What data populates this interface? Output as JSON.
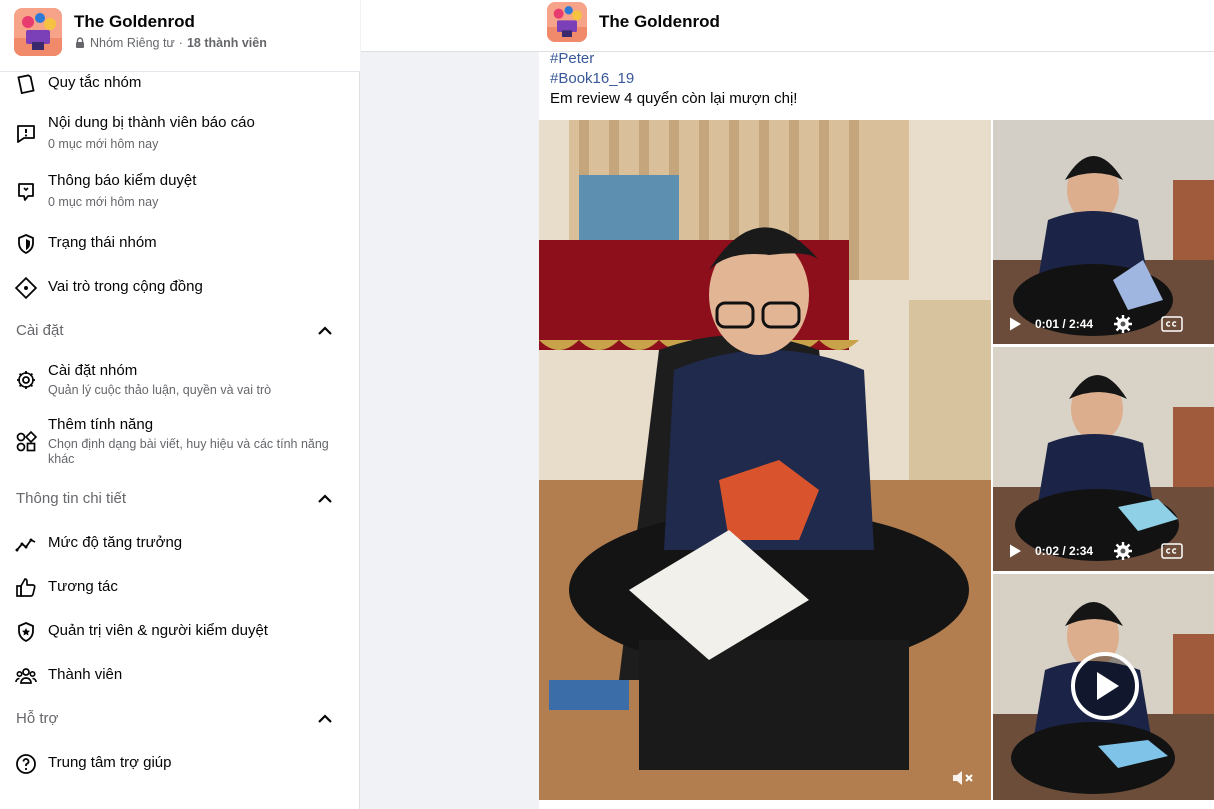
{
  "group": {
    "name": "The Goldenrod",
    "privacy": "Nhóm Riêng tư",
    "separator": "·",
    "members": "18 thành viên"
  },
  "sidebar": {
    "items": [
      {
        "label": "Quy tắc nhóm",
        "icon": "rules-icon"
      },
      {
        "label": "Nội dung bị thành viên báo cáo",
        "sub": "0 mục mới hôm nay",
        "icon": "report-icon"
      },
      {
        "label": "Thông báo kiểm duyệt",
        "sub": "0 mục mới hôm nay",
        "icon": "moderation-alert-icon"
      },
      {
        "label": "Trạng thái nhóm",
        "icon": "shield-icon"
      },
      {
        "label": "Vai trò trong cộng đồng",
        "icon": "community-role-icon"
      }
    ],
    "settings": {
      "heading": "Cài đặt",
      "items": [
        {
          "label": "Cài đặt nhóm",
          "sub": "Quản lý cuộc thảo luận, quyền và vai trò",
          "icon": "gear-icon"
        },
        {
          "label": "Thêm tính năng",
          "sub": "Chọn định dạng bài viết, huy hiệu và các tính năng khác",
          "icon": "shapes-icon"
        }
      ]
    },
    "insights": {
      "heading": "Thông tin chi tiết",
      "items": [
        {
          "label": "Mức độ tăng trưởng",
          "icon": "growth-icon"
        },
        {
          "label": "Tương tác",
          "icon": "thumbs-up-icon"
        },
        {
          "label": "Quản trị viên & người kiểm duyệt",
          "icon": "admin-badge-icon"
        },
        {
          "label": "Thành viên",
          "icon": "members-icon"
        }
      ]
    },
    "support": {
      "heading": "Hỗ trợ",
      "items": [
        {
          "label": "Trung tâm trợ giúp",
          "icon": "help-icon"
        }
      ]
    }
  },
  "post": {
    "tags": [
      "#Peter",
      "#Book16_19"
    ],
    "text": "Em review 4 quyển còn lại mượn chị!",
    "videos": [
      {
        "time": "0:01 / 2:44"
      },
      {
        "time": "0:02 / 2:34"
      }
    ]
  },
  "colors": {
    "link": "#385898",
    "secondary_text": "#65676b",
    "background": "#f0f2f5"
  }
}
